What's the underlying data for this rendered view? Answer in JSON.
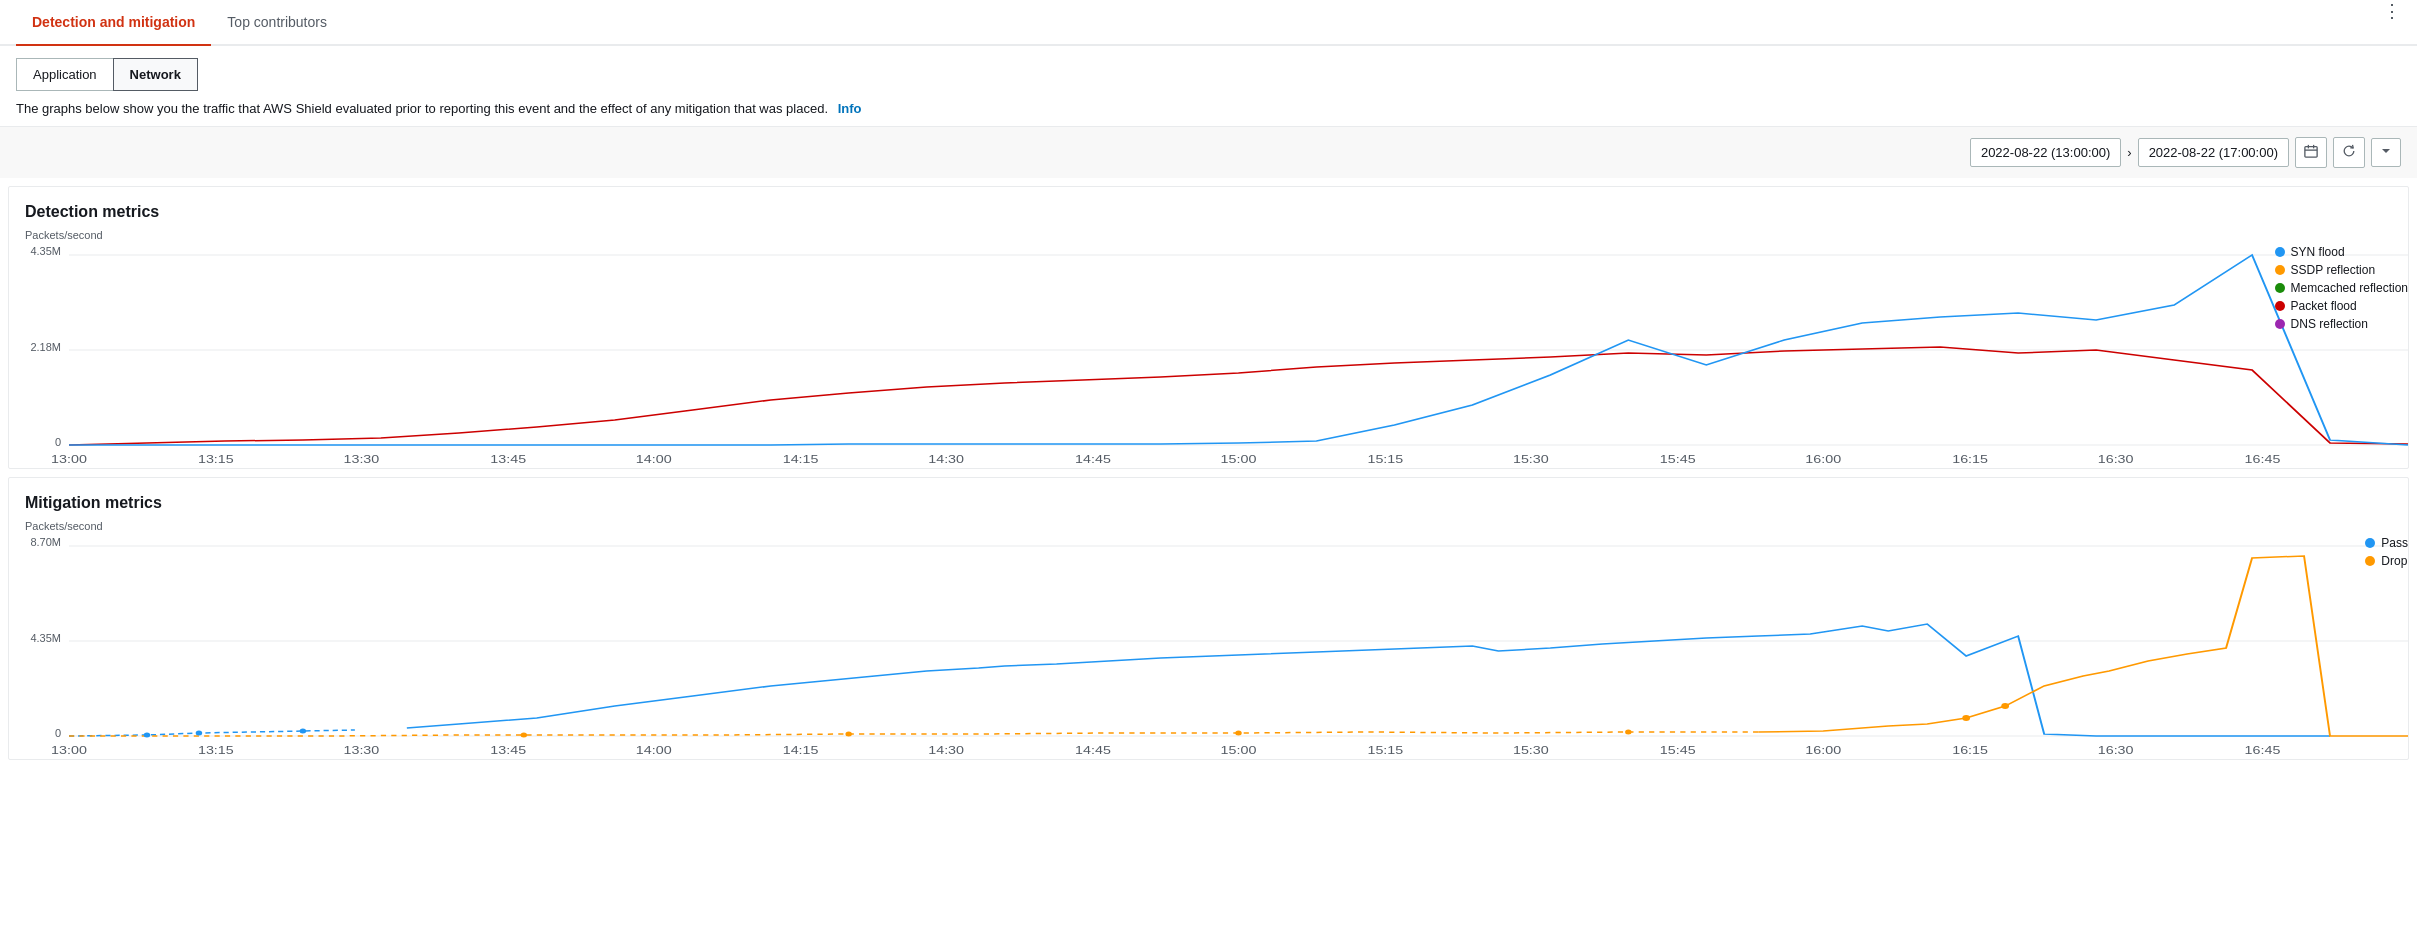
{
  "tabs": {
    "active": "detection-mitigation",
    "items": [
      {
        "id": "detection-mitigation",
        "label": "Detection and mitigation"
      },
      {
        "id": "top-contributors",
        "label": "Top contributors"
      }
    ]
  },
  "subTabs": {
    "items": [
      {
        "id": "application",
        "label": "Application"
      },
      {
        "id": "network",
        "label": "Network",
        "active": true
      }
    ]
  },
  "infoBar": {
    "text": "The graphs below show you the traffic that AWS Shield evaluated prior to reporting this event and the effect of any mitigation that was placed.",
    "linkLabel": "Info"
  },
  "timeRange": {
    "start": "2022-08-22 (13:00:00)",
    "end": "2022-08-22 (17:00:00)",
    "arrowLabel": "›"
  },
  "detectionMetrics": {
    "title": "Detection metrics",
    "yLabel": "Packets/second",
    "yValues": [
      "4.35M",
      "2.18M",
      "0"
    ],
    "xLabels": [
      "13:00",
      "13:15",
      "13:30",
      "13:45",
      "14:00",
      "14:15",
      "14:30",
      "14:45",
      "15:00",
      "15:15",
      "15:30",
      "15:45",
      "16:00",
      "16:15",
      "16:30",
      "16:45"
    ],
    "legend": [
      {
        "label": "SYN flood",
        "color": "#2196f3"
      },
      {
        "label": "SSDP reflection",
        "color": "#ff9900"
      },
      {
        "label": "Memcached reflection",
        "color": "#1b8c0a"
      },
      {
        "label": "Packet flood",
        "color": "#cc0000"
      },
      {
        "label": "DNS reflection",
        "color": "#9c27b0"
      }
    ]
  },
  "mitigationMetrics": {
    "title": "Mitigation metrics",
    "yLabel": "Packets/second",
    "yValues": [
      "8.70M",
      "4.35M",
      "0"
    ],
    "xLabels": [
      "13:00",
      "13:15",
      "13:30",
      "13:45",
      "14:00",
      "14:15",
      "14:30",
      "14:45",
      "15:00",
      "15:15",
      "15:30",
      "15:45",
      "16:00",
      "16:15",
      "16:30",
      "16:45"
    ],
    "legend": [
      {
        "label": "Pass",
        "color": "#2196f3"
      },
      {
        "label": "Drop",
        "color": "#ff9900"
      }
    ]
  }
}
